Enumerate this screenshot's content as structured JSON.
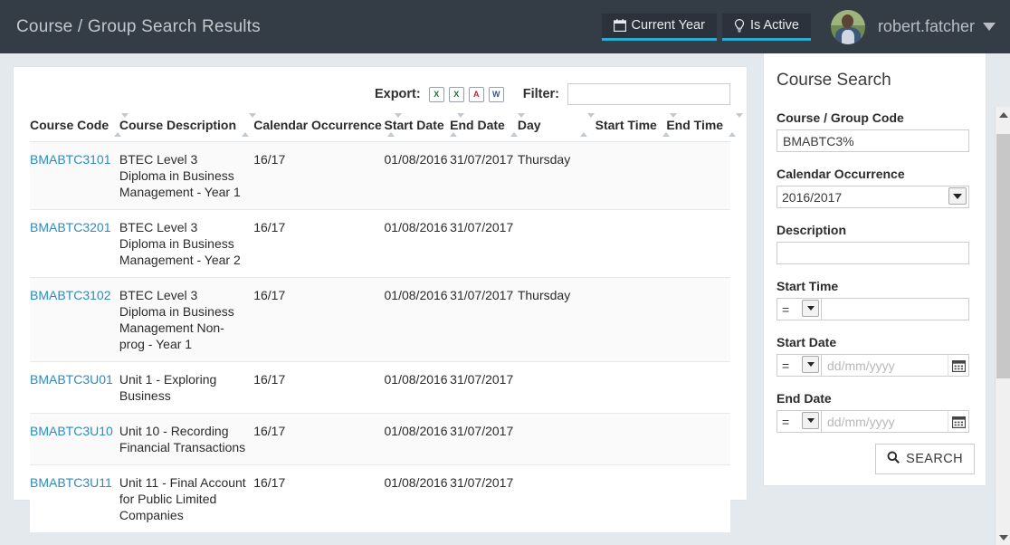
{
  "topbar": {
    "title": "Course / Group Search Results",
    "current_year_label": "Current Year",
    "current_year_icon": "calendar-icon",
    "is_active_label": "Is Active",
    "is_active_icon": "lightbulb-icon",
    "username": "robert.fatcher",
    "user_caret_icon": "chevron-down-icon",
    "avatar_icon": "user-avatar",
    "accent_color": "#2aabd2",
    "bar_color": "#343c46"
  },
  "toolbar": {
    "export_label": "Export:",
    "export_options": [
      {
        "name": "export-xml-icon",
        "glyph": "X",
        "title": "XML"
      },
      {
        "name": "export-excel-icon",
        "glyph": "X",
        "title": "Excel"
      },
      {
        "name": "export-pdf-icon",
        "glyph": "A",
        "title": "PDF"
      },
      {
        "name": "export-word-icon",
        "glyph": "W",
        "title": "Word"
      }
    ],
    "filter_label": "Filter:",
    "filter_value": "",
    "filter_placeholder": ""
  },
  "table": {
    "columns": [
      "Course Code",
      "Course Description",
      "Calendar Occurrence",
      "Start Date",
      "End Date",
      "Day",
      "Start Time",
      "End Time"
    ],
    "sort_icon": "sort-arrows-icon",
    "rows": [
      {
        "code": "BMABTC3101",
        "description": "BTEC Level 3 Diploma in Business Management - Year 1",
        "occurrence": "16/17",
        "start_date": "01/08/2016",
        "end_date": "31/07/2017",
        "day": "Thursday",
        "start_time": "",
        "end_time": ""
      },
      {
        "code": "BMABTC3201",
        "description": "BTEC Level 3 Diploma in Business Management - Year 2",
        "occurrence": "16/17",
        "start_date": "01/08/2016",
        "end_date": "31/07/2017",
        "day": "",
        "start_time": "",
        "end_time": ""
      },
      {
        "code": "BMABTC3102",
        "description": "BTEC Level 3 Diploma in Business Management Non-prog - Year 1",
        "occurrence": "16/17",
        "start_date": "01/08/2016",
        "end_date": "31/07/2017",
        "day": "Thursday",
        "start_time": "",
        "end_time": ""
      },
      {
        "code": "BMABTC3U01",
        "description": "Unit 1 - Exploring Business",
        "occurrence": "16/17",
        "start_date": "01/08/2016",
        "end_date": "31/07/2017",
        "day": "",
        "start_time": "",
        "end_time": ""
      },
      {
        "code": "BMABTC3U10",
        "description": "Unit 10 - Recording Financial Transactions",
        "occurrence": "16/17",
        "start_date": "01/08/2016",
        "end_date": "31/07/2017",
        "day": "",
        "start_time": "",
        "end_time": ""
      },
      {
        "code": "BMABTC3U11",
        "description": "Unit 11 - Final Account for Public Limited Companies",
        "occurrence": "16/17",
        "start_date": "01/08/2016",
        "end_date": "31/07/2017",
        "day": "",
        "start_time": "",
        "end_time": ""
      }
    ]
  },
  "search_panel": {
    "title": "Course Search",
    "course_code": {
      "label": "Course / Group Code",
      "value": "BMABTC3%",
      "placeholder": ""
    },
    "calendar_occurrence": {
      "label": "Calendar Occurrence",
      "value": "2016/2017",
      "options": [
        "2016/2017"
      ]
    },
    "description": {
      "label": "Description",
      "value": "",
      "placeholder": ""
    },
    "start_time": {
      "label": "Start Time",
      "operator": "=",
      "operators": [
        "="
      ],
      "value": "",
      "placeholder": ""
    },
    "start_date": {
      "label": "Start Date",
      "operator": "=",
      "operators": [
        "="
      ],
      "value": "",
      "placeholder": "dd/mm/yyyy",
      "calendar_icon": "calendar-icon"
    },
    "end_date": {
      "label": "End Date",
      "operator": "=",
      "operators": [
        "="
      ],
      "value": "",
      "placeholder": "dd/mm/yyyy",
      "calendar_icon": "calendar-icon"
    },
    "search_button": {
      "label": "SEARCH",
      "icon": "magnifier-icon"
    }
  }
}
